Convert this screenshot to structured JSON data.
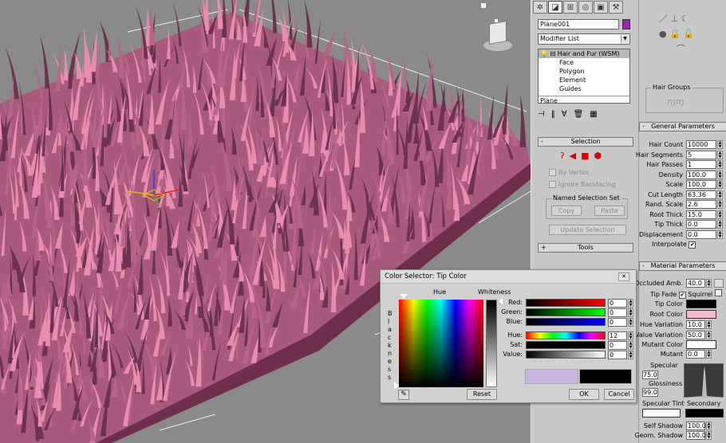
{
  "command_panel": {
    "tabs": [
      "create-icon",
      "modify-icon",
      "hierarchy-icon",
      "motion-icon",
      "display-icon",
      "utilities-icon"
    ],
    "object_name": "Plane001",
    "object_color": "#a61fb8",
    "modifier_list_label": "Modifier List",
    "stack": {
      "modifier": "Hair and Fur (WSM)",
      "subobjects": [
        "Face",
        "Polygon",
        "Element",
        "Guides"
      ],
      "base": "Plane"
    },
    "selection_rollout": {
      "title": "Selection",
      "by_vertex": "By Vertex",
      "ignore_backfacing": "Ignore Backfacing",
      "named_selection_set": "Named Selection Set",
      "copy": "Copy",
      "paste": "Paste",
      "update_selection": "Update Selection"
    },
    "tools_rollout": "Tools"
  },
  "right_panel": {
    "hair_groups": "Hair Groups",
    "general_parameters": {
      "title": "General Parameters",
      "params": [
        {
          "label": "Hair Count",
          "value": "10000"
        },
        {
          "label": "Hair Segments",
          "value": "5"
        },
        {
          "label": "Hair Passes",
          "value": "1"
        },
        {
          "label": "Density",
          "value": "100.0"
        },
        {
          "label": "Scale",
          "value": "100.0"
        },
        {
          "label": "Cut Length",
          "value": "63.36"
        },
        {
          "label": "Rand. Scale",
          "value": "2.6"
        },
        {
          "label": "Root Thick",
          "value": "15.0"
        },
        {
          "label": "Tip Thick",
          "value": "0.0"
        },
        {
          "label": "Displacement",
          "value": "0.0"
        }
      ],
      "interpolate": "Interpolate"
    },
    "material_parameters": {
      "title": "Material Parameters",
      "occluded_amb_label": "Occluded Amb.",
      "occluded_amb": "40.0",
      "tip_fade": "Tip Fade",
      "squirrel": "Squirrel",
      "tip_color_label": "Tip Color",
      "tip_color": "#000000",
      "root_color_label": "Root Color",
      "root_color": "#f5b8cf",
      "hue_variation_label": "Hue Variation",
      "hue_variation": "10.0",
      "value_variation_label": "Value Variation",
      "value_variation": "50.0",
      "mutant_color_label": "Mutant Color",
      "mutant_color": "#ffffff",
      "mutant_label": "Mutant",
      "mutant": "0.0",
      "specular_label": "Specular",
      "specular": "75.0",
      "glossiness_label": "Glossiness",
      "glossiness": "99.0",
      "specular_tint": "Specular Tint",
      "secondary": "Secondary",
      "self_shadow_label": "Self Shadow",
      "self_shadow": "100.0",
      "geom_shadow_label": "Geom. Shadow",
      "geom_shadow": "100.0"
    }
  },
  "color_dialog": {
    "title": "Color Selector: Tip Color",
    "hue_label": "Hue",
    "whiteness_label": "Whiteness",
    "blackness_label": "B l a c k n e s s",
    "channels": [
      {
        "label": "Red:",
        "value": "0"
      },
      {
        "label": "Green:",
        "value": "0"
      },
      {
        "label": "Blue:",
        "value": "0"
      },
      {
        "label": "Hue:",
        "value": "12"
      },
      {
        "label": "Sat:",
        "value": "0"
      },
      {
        "label": "Value:",
        "value": "0"
      }
    ],
    "reset": "Reset",
    "ok": "OK",
    "cancel": "Cancel",
    "old_color": "#c8b4de",
    "new_color": "#000000"
  }
}
